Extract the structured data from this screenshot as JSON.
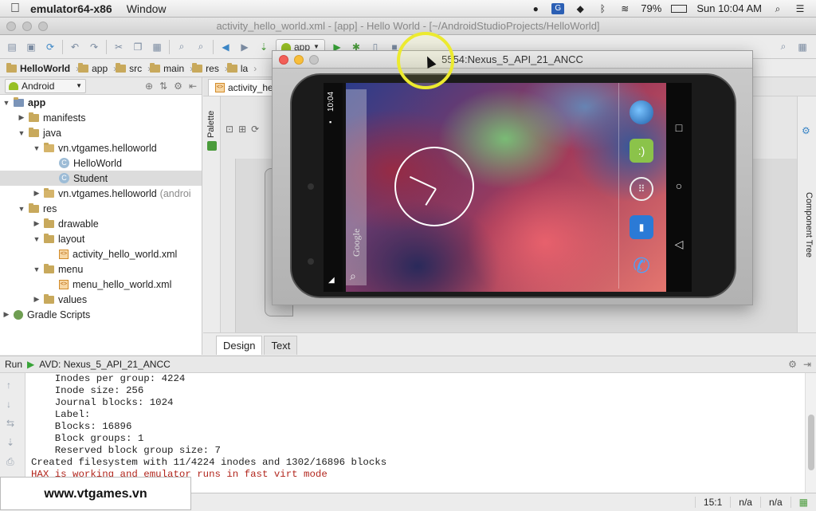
{
  "menubar": {
    "app_name": "emulator64-x86",
    "menu_window": "Window",
    "battery": "79%",
    "clock": "Sun 10:04 AM"
  },
  "ide": {
    "title": "activity_hello_world.xml - [app] - Hello World - [~/AndroidStudioProjects/HelloWorld]",
    "run_config": "app"
  },
  "breadcrumb": [
    "HelloWorld",
    "app",
    "src",
    "main",
    "res",
    "la"
  ],
  "project": {
    "view_mode": "Android",
    "tree": [
      {
        "label": "app",
        "depth": 0,
        "arrow": "▼",
        "icon": "module"
      },
      {
        "label": "manifests",
        "depth": 1,
        "arrow": "▶",
        "icon": "folder"
      },
      {
        "label": "java",
        "depth": 1,
        "arrow": "▼",
        "icon": "folder"
      },
      {
        "label": "vn.vtgames.helloworld",
        "depth": 2,
        "arrow": "▼",
        "icon": "package"
      },
      {
        "label": "HelloWorld",
        "depth": 3,
        "arrow": "",
        "icon": "class"
      },
      {
        "label": "Student",
        "depth": 3,
        "arrow": "",
        "icon": "class",
        "selected": true
      },
      {
        "label": "vn.vtgames.helloworld",
        "suffix": "(androi",
        "depth": 2,
        "arrow": "▶",
        "icon": "package"
      },
      {
        "label": "res",
        "depth": 1,
        "arrow": "▼",
        "icon": "folder"
      },
      {
        "label": "drawable",
        "depth": 2,
        "arrow": "▶",
        "icon": "folder"
      },
      {
        "label": "layout",
        "depth": 2,
        "arrow": "▼",
        "icon": "folder"
      },
      {
        "label": "activity_hello_world.xml",
        "depth": 3,
        "arrow": "",
        "icon": "xml"
      },
      {
        "label": "menu",
        "depth": 2,
        "arrow": "▼",
        "icon": "folder"
      },
      {
        "label": "menu_hello_world.xml",
        "depth": 3,
        "arrow": "",
        "icon": "xml"
      },
      {
        "label": "values",
        "depth": 2,
        "arrow": "▶",
        "icon": "folder"
      },
      {
        "label": "Gradle Scripts",
        "depth": 0,
        "arrow": "▶",
        "icon": "gradle"
      }
    ]
  },
  "editor": {
    "tab_label": "activity_he",
    "palette_label": "Palette",
    "component_tree_label": "Component Tree",
    "design_tab": "Design",
    "text_tab": "Text"
  },
  "emulator": {
    "title": "5554:Nexus_5_API_21_ANCC",
    "status_time": "10:04",
    "search_hint": "Google"
  },
  "run": {
    "label": "Run",
    "config": "AVD: Nexus_5_API_21_ANCC",
    "console_lines": [
      {
        "text": "    Inodes per group: 4224",
        "err": false
      },
      {
        "text": "    Inode size: 256",
        "err": false
      },
      {
        "text": "    Journal blocks: 1024",
        "err": false
      },
      {
        "text": "    Label:",
        "err": false
      },
      {
        "text": "    Blocks: 16896",
        "err": false
      },
      {
        "text": "    Block groups: 1",
        "err": false
      },
      {
        "text": "    Reserved block group size: 7",
        "err": false
      },
      {
        "text": "Created filesystem with 11/4224 inodes and 1302/16896 blocks",
        "err": false
      },
      {
        "text": "HAX is working and emulator runs in fast virt mode",
        "err": true
      }
    ]
  },
  "statusbar": {
    "position": "15:1",
    "line_sep": "n/a",
    "encoding": "n/a"
  },
  "watermark": "www.vtgames.vn"
}
